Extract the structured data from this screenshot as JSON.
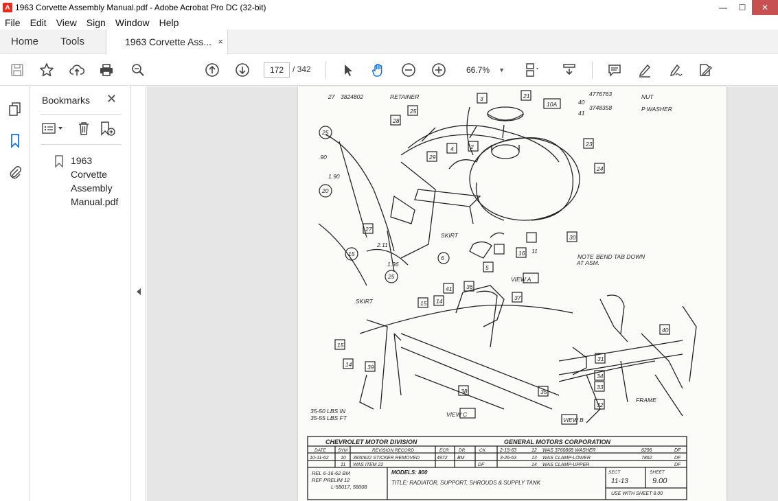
{
  "window": {
    "title": "1963 Corvette Assembly Manual.pdf - Adobe Acrobat Pro DC (32-bit)",
    "app_icon": "A",
    "min": "—",
    "max": "☐",
    "close": "✕"
  },
  "menu": [
    "File",
    "Edit",
    "View",
    "Sign",
    "Window",
    "Help"
  ],
  "tabs": {
    "home": "Home",
    "tools": "Tools",
    "document": "1963 Corvette Ass...",
    "close": "×"
  },
  "toolbar": {
    "page_current": "172",
    "page_total": "/ 342",
    "zoom": "66.7%",
    "zoom_caret": "▼"
  },
  "bookmarks": {
    "title": "Bookmarks",
    "close": "✕",
    "items": [
      {
        "label": "1963 Corvette Assembly Manual.pdf"
      }
    ]
  },
  "drawing": {
    "top_parts": [
      {
        "num": "27",
        "part": "3824802",
        "name": "RETAINER"
      },
      {
        "num": "40",
        "part": "4776763",
        "name": "NUT"
      },
      {
        "num": "41",
        "part": "3748358",
        "name": "P WASHER"
      }
    ],
    "callouts": [
      "3",
      "21",
      "10A",
      "25",
      "28",
      "29",
      "2",
      "4",
      "23",
      "24",
      "25",
      "20",
      "27",
      "30",
      "16",
      "11",
      "15",
      "25",
      "5",
      "6",
      "41",
      "36",
      "37",
      "14",
      "15",
      "15",
      "14",
      "39",
      "38",
      "35",
      "31",
      "34",
      "33",
      "32",
      "40"
    ],
    "dims": [
      ".90",
      "1.90",
      "2.11",
      "1.36"
    ],
    "labels": {
      "skirt1": "SKIRT",
      "skirt2": "SKIRT",
      "note": "NOTE",
      "note_text": "BEND TAB DOWN",
      "note_text2": "AT ASM.",
      "frame": "FRAME",
      "view_a": "VIEW A",
      "view_b": "VIEW B",
      "view_c": "VIEW C"
    },
    "torque": [
      "35-50 LBS IN",
      "35-55 LBS FT"
    ],
    "title_block": {
      "division": "CHEVROLET MOTOR DIVISION",
      "corporation": "GENERAL MOTORS CORPORATION",
      "hdr_date": "DATE",
      "hdr_sym": "SYM",
      "hdr_rev": "REVISION RECORD",
      "hdr_ecr": "ECR",
      "hdr_dr": "DR",
      "hdr_ck": "CK",
      "rev1_date": "10-11-62",
      "rev1_sym": "10",
      "rev1_text": "3830622 STICKER REMOVED",
      "rev1_ecr": "4972",
      "rev1_dr": "BM",
      "rev2_sym": "11",
      "rev2_text": "WAS ITEM 22",
      "rev2_dr": "DF",
      "rev3_date": "2-15-63",
      "rev3_sym": "12",
      "rev3_text": "WAS 3760868 WASHER",
      "rev3_ecr": "6296",
      "rev3_dr": "DF",
      "rev4_date": "3-26-63",
      "rev4_sym": "13",
      "rev4_text": "WAS CLAMP-LOWER",
      "rev4_ecr": "7862",
      "rev4_dr": "DF",
      "rev5_sym": "14",
      "rev5_text": "WAS CLAMP-UPPER",
      "rev5_dr": "DF",
      "rel": "REL 6-16-62 BM",
      "ref": "REF PRELIM 12",
      "lnum": "L-58017, 58008",
      "models": "MODELS: 800",
      "title": "TITLE: RADIATOR, SUPPORT, SHROUDS & SUPPLY TANK",
      "sect_label": "SECT",
      "sect": "11-13",
      "sheet_label": "SHEET",
      "sheet": "9.00",
      "use_with": "USE WITH SHEET 8.00"
    }
  }
}
